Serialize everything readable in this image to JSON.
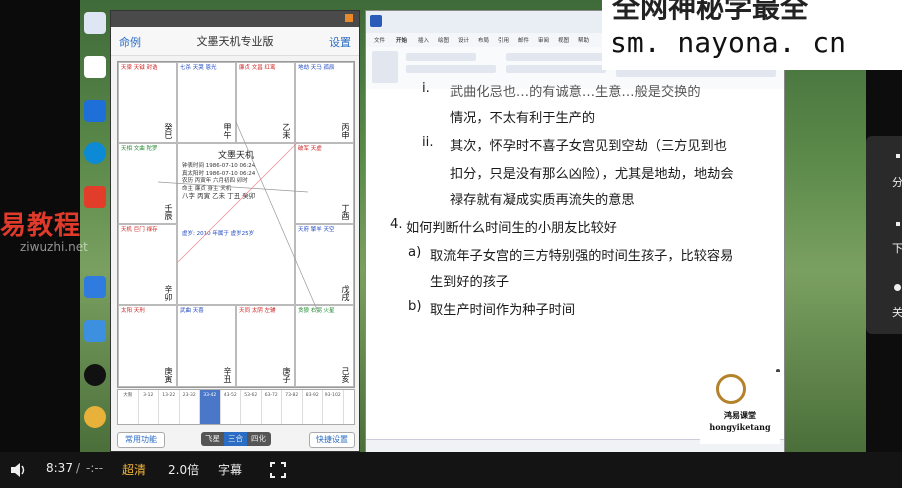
{
  "watermark": {
    "line1": "易教程",
    "line2": "ziwuzhi.net"
  },
  "banner": {
    "line1": "全网神秘学最全",
    "url": "sm. nayona. cn"
  },
  "phone": {
    "title": "文墨天机专业版",
    "back_label": "命例",
    "settings_label": "设置",
    "center": {
      "name": "文墨天机",
      "lines": [
        "钟表时间 1986-07-10 06:24",
        "真太阳时 1986-07-10 06:24",
        "农历 丙寅年 六月初四 卯时",
        "命主 廉贞  身主 天机",
        "八字 丙寅 乙未 丁丑 癸卯"
      ],
      "note": "虚岁: 2010 年属于 虚岁25岁"
    },
    "bottom": {
      "left_btn": "常用功能",
      "seg": [
        "飞星",
        "三合",
        "四化"
      ],
      "right_btn": "快捷设置"
    },
    "dayun_label": "大限"
  },
  "word": {
    "tabs": [
      "文件",
      "开始",
      "插入",
      "绘图",
      "设计",
      "布局",
      "引用",
      "邮件",
      "审阅",
      "视图",
      "帮助"
    ],
    "lines": [
      {
        "prefix": "i.",
        "text": "武曲化忌也…的有诚意…生意…般是交换的"
      },
      {
        "prefix": "",
        "text": "情况，不太有利于生产的"
      },
      {
        "prefix": "ii.",
        "text": "其次，怀孕时不喜子女宫见到空劫（三方见到也"
      },
      {
        "prefix": "",
        "text": "扣分，只是没有那么凶险），尤其是地劫，地劫会"
      },
      {
        "prefix": "",
        "text": "禄存就有凝成实质再流失的意思"
      },
      {
        "prefix": "4.",
        "text": "如何判断什么时间生的小朋友比较好"
      },
      {
        "prefix": "a)",
        "text": "取流年子女宫的三方特别强的时间生孩子，比较容易"
      },
      {
        "prefix": "",
        "text": "生到好的孩子"
      },
      {
        "prefix": "b)",
        "text": "取生产时间作为种子时间"
      }
    ]
  },
  "logo": {
    "cn": "鸿易课堂",
    "en": "hongyiketang"
  },
  "right_panel": {
    "items": [
      "分",
      "下",
      "关"
    ]
  },
  "player": {
    "time": "8:37",
    "sep": "/",
    "total": "-:--",
    "quality": "超清",
    "speed": "2.0倍",
    "subtitle": "字幕"
  },
  "palaces": [
    {
      "stars": "天梁 天钺 封诰",
      "gz": "癸巳"
    },
    {
      "stars": "七杀 天哭 恩光",
      "gz": "甲午"
    },
    {
      "stars": "廉贞 文昌 红鸾",
      "gz": "乙未"
    },
    {
      "stars": "地劫 天马 孤辰",
      "gz": "丙申"
    },
    {
      "stars": "天相 文曲 陀罗",
      "gz": "壬辰"
    },
    {
      "stars": "破军 天虚",
      "gz": "丁酉"
    },
    {
      "stars": "天机 巨门 禄存",
      "gz": "辛卯"
    },
    {
      "stars": "天府 擎羊 天空",
      "gz": "戊戌"
    },
    {
      "stars": "太阳 天刑",
      "gz": "庚寅"
    },
    {
      "stars": "武曲 天喜",
      "gz": "辛丑"
    },
    {
      "stars": "天同 太阴 左辅",
      "gz": "庚子"
    },
    {
      "stars": "贪狼 右弼 火星",
      "gz": "己亥"
    }
  ],
  "dayun": [
    "3-12",
    "13-22",
    "23-32",
    "33-42",
    "43-52",
    "53-62",
    "63-72",
    "73-82",
    "83-92",
    "93-102",
    "103-112"
  ]
}
